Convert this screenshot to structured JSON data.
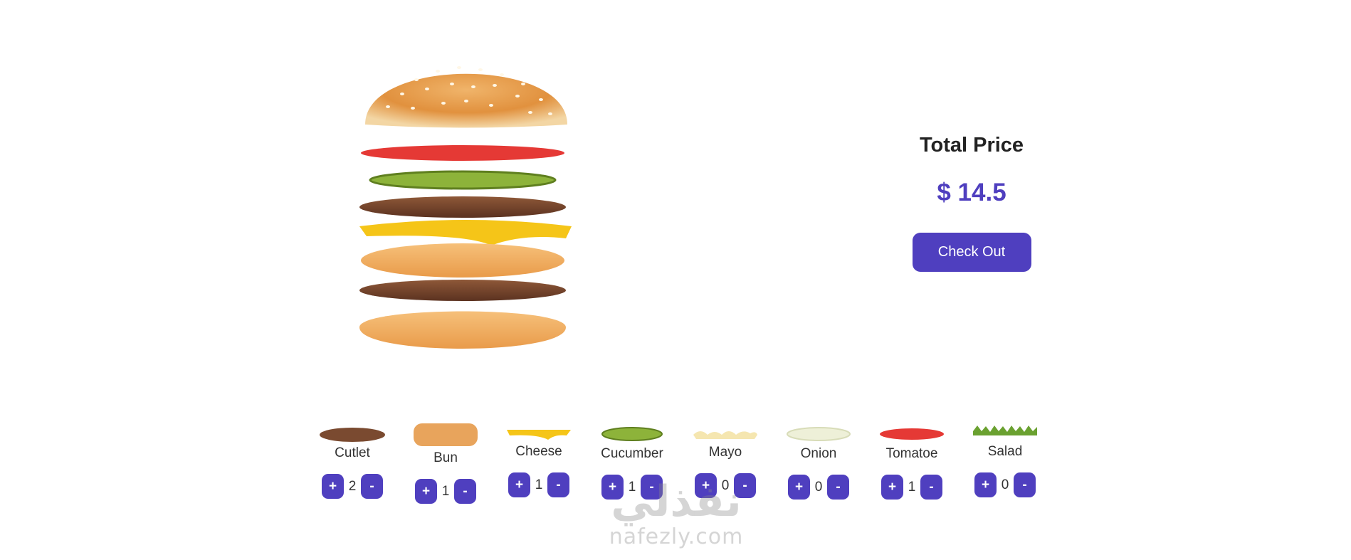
{
  "summary": {
    "title": "Total Price",
    "price": "$ 14.5",
    "checkout_label": "Check Out"
  },
  "ingredients": [
    {
      "name": "Cutlet",
      "quantity": "2",
      "icon": "cutlet-icon"
    },
    {
      "name": "Bun",
      "quantity": "1",
      "icon": "bun-icon"
    },
    {
      "name": "Cheese",
      "quantity": "1",
      "icon": "cheese-icon"
    },
    {
      "name": "Cucumber",
      "quantity": "1",
      "icon": "cucumber-icon"
    },
    {
      "name": "Mayo",
      "quantity": "0",
      "icon": "mayo-icon"
    },
    {
      "name": "Onion",
      "quantity": "0",
      "icon": "onion-icon"
    },
    {
      "name": "Tomatoe",
      "quantity": "1",
      "icon": "tomato-icon"
    },
    {
      "name": "Salad",
      "quantity": "0",
      "icon": "salad-icon"
    }
  ],
  "buttons": {
    "plus": "+",
    "minus": "-"
  },
  "watermark": {
    "arabic": "نفذلي",
    "latin": "nafezly.com"
  },
  "colors": {
    "accent": "#4f3fbf",
    "bun": "#e8a45c",
    "cutlet": "#7a4a30",
    "cheese": "#f5c518",
    "tomato": "#e53935",
    "cucumber": "#8db33a",
    "onion": "#eef0d8",
    "mayo": "#f5e6b0",
    "salad": "#6aa130"
  }
}
